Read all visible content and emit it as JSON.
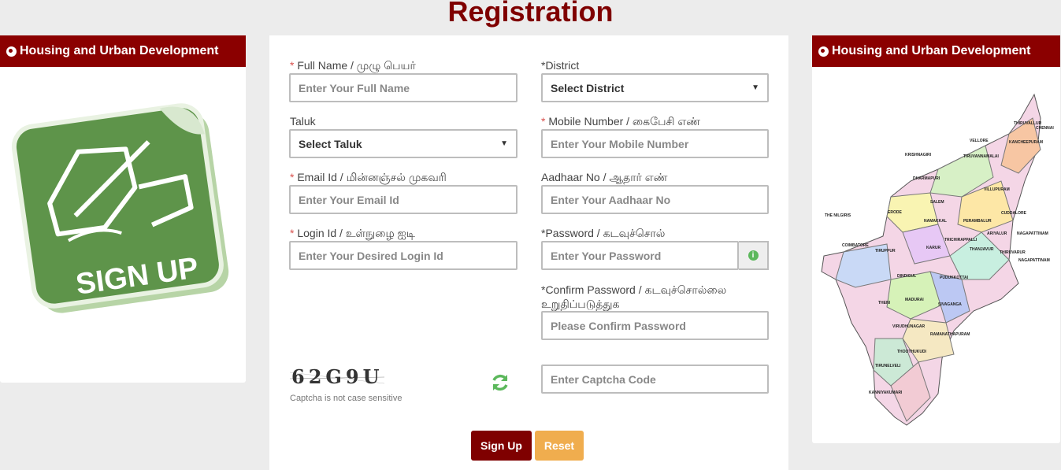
{
  "page": {
    "title": "Registration"
  },
  "left_panel": {
    "title": "Housing and Urban Development",
    "image_text": "SIGN UP"
  },
  "right_panel": {
    "title": "Housing and Urban Development",
    "map_labels": [
      "THIRUVALLUR",
      "CHENNAI",
      "VELLORE",
      "KANCHEEPURAM",
      "KRISHNAGIRI",
      "TIRUVANNAMALAI",
      "DHARMAPURI",
      "VILLUPURAM",
      "SALEM",
      "ERODE",
      "NAMAKKAL",
      "CUDDALORE",
      "THE NILGIRIS",
      "PERAMBALUR",
      "ARIYALUR",
      "NAGAPATTINAM",
      "KARUR",
      "TRICHIRAPPALLI",
      "COIMBATORE",
      "TIRUPPUR",
      "THANJAVUR",
      "THIRUVARUR",
      "DINDIGUL",
      "PUDUKKOTTAI",
      "NAGAPATTINAM",
      "THENI",
      "MADURAI",
      "SIVAGANGA",
      "VIRUDHUNAGAR",
      "RAMANATHAPURAM",
      "THOOTHUKUDI",
      "TIRUNELVELI",
      "KANNIYAKUMARI"
    ]
  },
  "form": {
    "full_name": {
      "label": "Full Name / முழு பெயர்",
      "placeholder": "Enter Your Full Name"
    },
    "district": {
      "label": "*District",
      "value": "Select District"
    },
    "taluk": {
      "label": "Taluk",
      "value": "Select Taluk"
    },
    "mobile": {
      "label": "Mobile Number / கைபேசி எண்",
      "placeholder": "Enter Your Mobile Number"
    },
    "email": {
      "label": "Email Id / மின்னஞ்சல் முகவரி",
      "placeholder": "Enter Your Email Id"
    },
    "aadhaar": {
      "label": "Aadhaar No / ஆதார் எண்",
      "placeholder": "Enter Your Aadhaar No"
    },
    "login": {
      "label": "Login Id / உள்நுழை ஐடி",
      "placeholder": "Enter Your Desired Login Id"
    },
    "password": {
      "label": "*Password / கடவுச்சொல்",
      "placeholder": "Enter Your Password"
    },
    "confirm": {
      "label_line1": "*Confirm Password / கடவுச்சொல்லை",
      "label_line2": "உறுதிப்படுத்துக",
      "placeholder": "Please Confirm Password"
    },
    "captcha": {
      "code": "62G9U",
      "note": "Captcha is not case sensitive",
      "placeholder": "Enter Captcha Code"
    },
    "required_mark": "*",
    "info_icon": "i",
    "signup_label": "Sign Up",
    "reset_label": "Reset"
  },
  "colors": {
    "brand": "#8b0000",
    "button_primary": "#7f0000",
    "button_warning": "#f0ad4e",
    "success": "#5cb85c"
  }
}
